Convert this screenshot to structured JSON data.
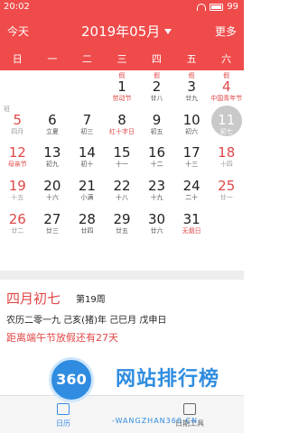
{
  "status": {
    "time": "20:02",
    "battery": "99"
  },
  "header": {
    "today_label": "今天",
    "month": "2019年05月",
    "more_label": "更多"
  },
  "weekdays": [
    "日",
    "一",
    "二",
    "三",
    "四",
    "五",
    "六"
  ],
  "days": [
    {
      "day": "",
      "lunar": ""
    },
    {
      "day": "",
      "lunar": ""
    },
    {
      "day": "",
      "lunar": ""
    },
    {
      "day": "1",
      "lunar": "劳动节",
      "tag": "假"
    },
    {
      "day": "2",
      "lunar": "廿八",
      "tag": "假"
    },
    {
      "day": "3",
      "lunar": "廿九",
      "tag": "假"
    },
    {
      "day": "4",
      "lunar": "中国青年节",
      "tag": "假"
    },
    {
      "day": "5",
      "lunar": "四月",
      "tag": "班"
    },
    {
      "day": "6",
      "lunar": "立夏"
    },
    {
      "day": "7",
      "lunar": "初三"
    },
    {
      "day": "8",
      "lunar": "红十字日"
    },
    {
      "day": "9",
      "lunar": "初五"
    },
    {
      "day": "10",
      "lunar": "初六"
    },
    {
      "day": "11",
      "lunar": "初七"
    },
    {
      "day": "12",
      "lunar": "母亲节"
    },
    {
      "day": "13",
      "lunar": "初九"
    },
    {
      "day": "14",
      "lunar": "初十"
    },
    {
      "day": "15",
      "lunar": "十一"
    },
    {
      "day": "16",
      "lunar": "十二"
    },
    {
      "day": "17",
      "lunar": "十三"
    },
    {
      "day": "18",
      "lunar": "十四"
    },
    {
      "day": "19",
      "lunar": "十五"
    },
    {
      "day": "20",
      "lunar": "十六"
    },
    {
      "day": "21",
      "lunar": "小满"
    },
    {
      "day": "22",
      "lunar": "十八"
    },
    {
      "day": "23",
      "lunar": "十九"
    },
    {
      "day": "24",
      "lunar": "二十"
    },
    {
      "day": "25",
      "lunar": "廿一"
    },
    {
      "day": "26",
      "lunar": "廿二"
    },
    {
      "day": "27",
      "lunar": "廿三"
    },
    {
      "day": "28",
      "lunar": "廿四"
    },
    {
      "day": "29",
      "lunar": "廿五"
    },
    {
      "day": "30",
      "lunar": "廿六"
    },
    {
      "day": "31",
      "lunar": "无烟日"
    }
  ],
  "info": {
    "lunar_date": "四月初七",
    "week": "第19周",
    "ganzhi": "农历二零一九 己亥(猪)年 己巳月 戊申日",
    "countdown": "距离端午节放假还有27天"
  },
  "bottom_nav": {
    "calendar": "日历",
    "tools": "日期工具"
  },
  "watermark": {
    "logo": "360",
    "title": "网站排行榜",
    "url": "-WANGZHAN360.CN-"
  }
}
